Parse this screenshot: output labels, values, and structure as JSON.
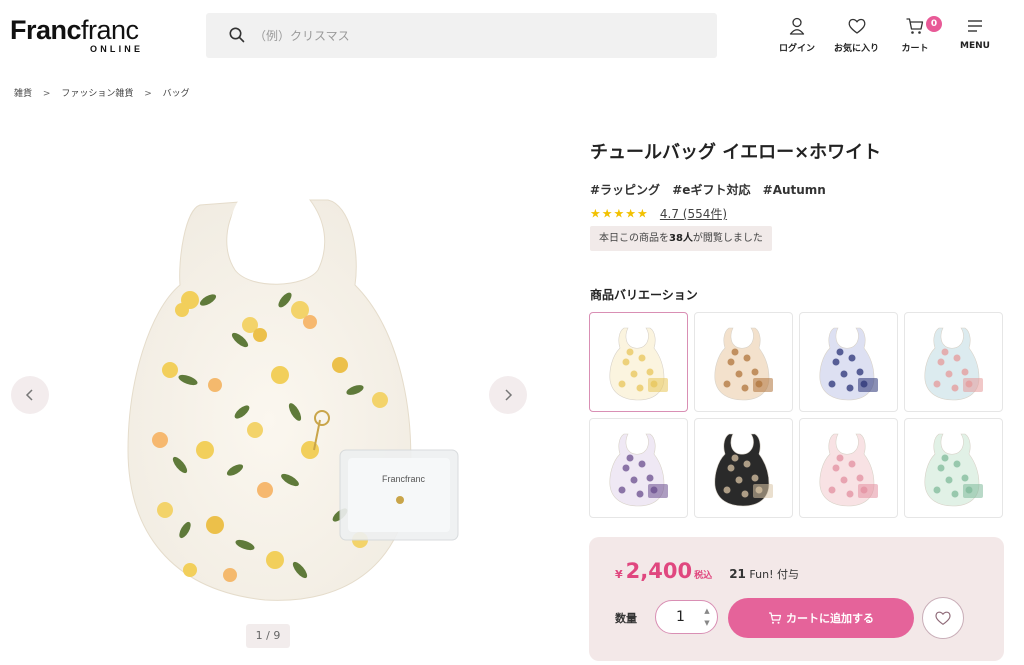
{
  "header": {
    "logo_bold": "Franc",
    "logo_light": "franc",
    "logo_sub": "ONLINE",
    "search_placeholder": "（例）クリスマス",
    "nav": {
      "login": "ログイン",
      "favorites": "お気に入り",
      "cart": "カート",
      "cart_count": "0",
      "menu": "MENU"
    }
  },
  "breadcrumb": {
    "items": [
      "雑貨",
      "ファッション雑貨",
      "バッグ"
    ],
    "separator": ">"
  },
  "gallery": {
    "pager": "1 / 9"
  },
  "product": {
    "title": "チュールバッグ イエロー×ホワイト",
    "tags": [
      "#ラッピング",
      "#eギフト対応",
      "#Autumn"
    ],
    "stars": "★★★★★",
    "rating": "4.7 (554件)",
    "views_prefix": "本日この商品を",
    "views_count": "38人",
    "views_suffix": "が閲覧しました",
    "variations_heading": "商品バリエーション",
    "variations": [
      {
        "color": "#fbf4df",
        "accent": "#e8c65a"
      },
      {
        "color": "#f3e1cc",
        "accent": "#b0743c"
      },
      {
        "color": "#dde0f2",
        "accent": "#2a3377"
      },
      {
        "color": "#dcebef",
        "accent": "#e59a9a"
      },
      {
        "color": "#efe8f4",
        "accent": "#6a4d8e"
      },
      {
        "color": "#2a2a2a",
        "accent": "#d9c4a6"
      },
      {
        "color": "#f8e2e4",
        "accent": "#e38fa0"
      },
      {
        "color": "#e1f1e6",
        "accent": "#7fb99a"
      }
    ]
  },
  "purchase": {
    "yen": "¥",
    "price": "2,400",
    "tax": "税込",
    "fun_points": "21",
    "fun_label": "Fun! 付与",
    "qty_label": "数量",
    "qty_value": "1",
    "add_to_cart": "カートに追加する"
  },
  "colors": {
    "accent_pink": "#e5639a",
    "price_pink": "#e0477f",
    "buybox_bg": "#f3e8e8"
  }
}
